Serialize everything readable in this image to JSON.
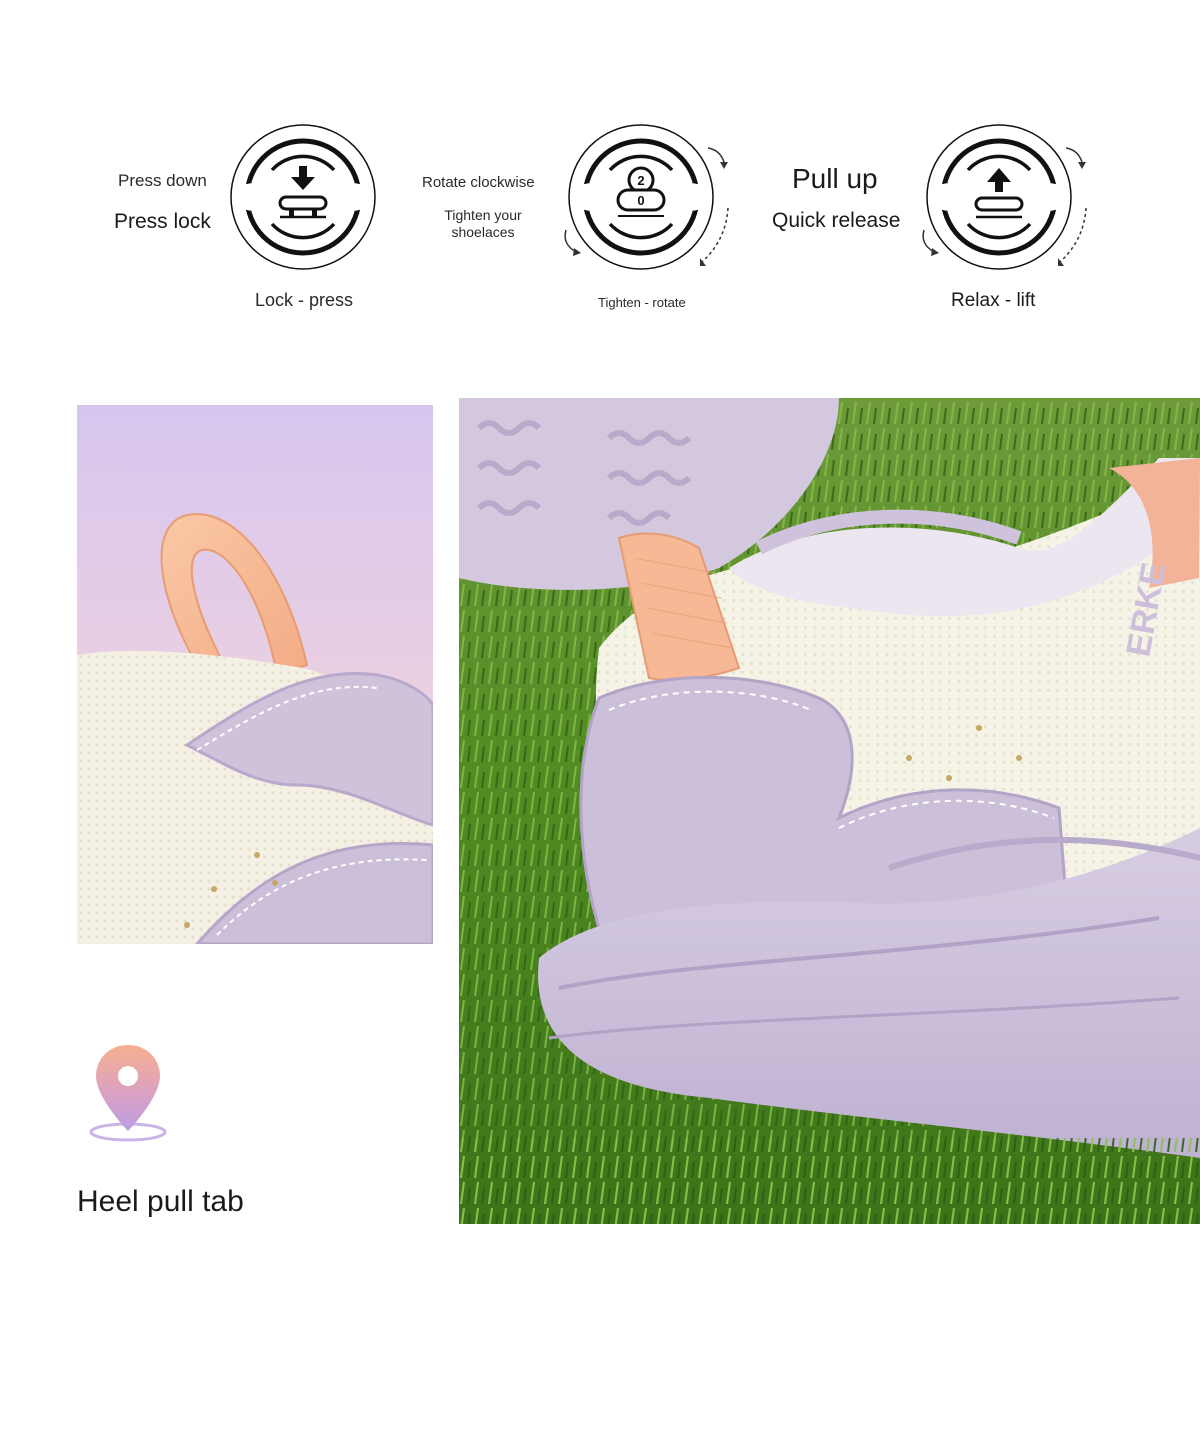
{
  "steps": [
    {
      "top_label": "Press down",
      "main_label": "Press lock",
      "bottom_label": "Lock - press",
      "dial_icon": "press-down-lock-icon"
    },
    {
      "top_label": "Rotate clockwise",
      "main_label": "Tighten your shoelaces",
      "bottom_label": "Tighten - rotate",
      "dial_icon": "rotate-tighten-icon",
      "dial_digits": [
        "2",
        "0"
      ]
    },
    {
      "top_label": "Pull up",
      "main_label": "Quick release",
      "bottom_label": "Relax - lift",
      "dial_icon": "pull-up-release-icon"
    }
  ],
  "feature": {
    "title": "Heel pull tab",
    "icon": "location-pin-icon"
  },
  "shoe_logo_text": "ERKE",
  "colors": {
    "lavender": "#c9bcd9",
    "peach": "#f6b894",
    "cream": "#f5f2e6",
    "grass": "#4f8a22",
    "dial_black": "#111111"
  }
}
